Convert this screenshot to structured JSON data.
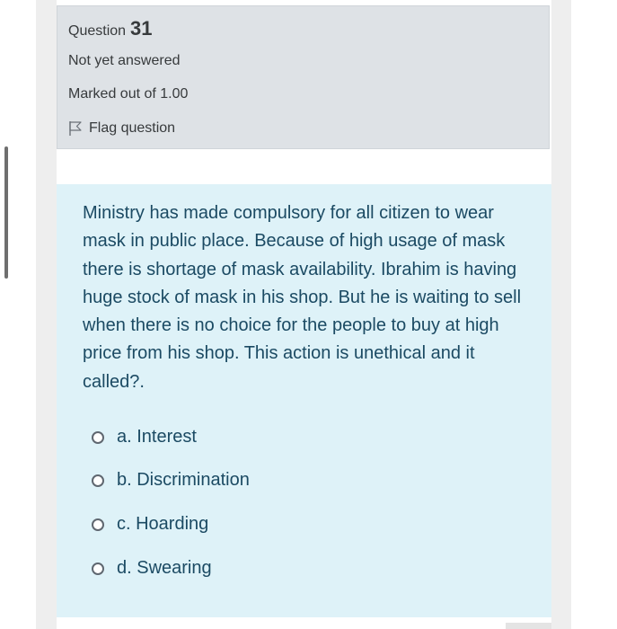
{
  "question_info": {
    "label": "Question",
    "number": "31",
    "state": "Not yet answered",
    "grade": "Marked out of 1.00",
    "flag_label": "Flag question",
    "flag_icon": "flag-icon"
  },
  "question": {
    "text": "Ministry has made compulsory for all citizen to wear mask in public place. Because of high usage of mask there is shortage of mask availability. Ibrahim is having huge stock of mask in his shop. But he is waiting to sell when there is no choice for the people to buy at high price from his shop. This action is unethical and it called?.",
    "answers": [
      {
        "label": "a. Interest"
      },
      {
        "label": "b. Discrimination"
      },
      {
        "label": "c. Hoarding"
      },
      {
        "label": "d. Swearing"
      }
    ]
  },
  "colors": {
    "info_background": "#dee2e6",
    "question_background": "#def2f8",
    "question_text": "#1b4a63",
    "info_text": "#373a3c"
  }
}
